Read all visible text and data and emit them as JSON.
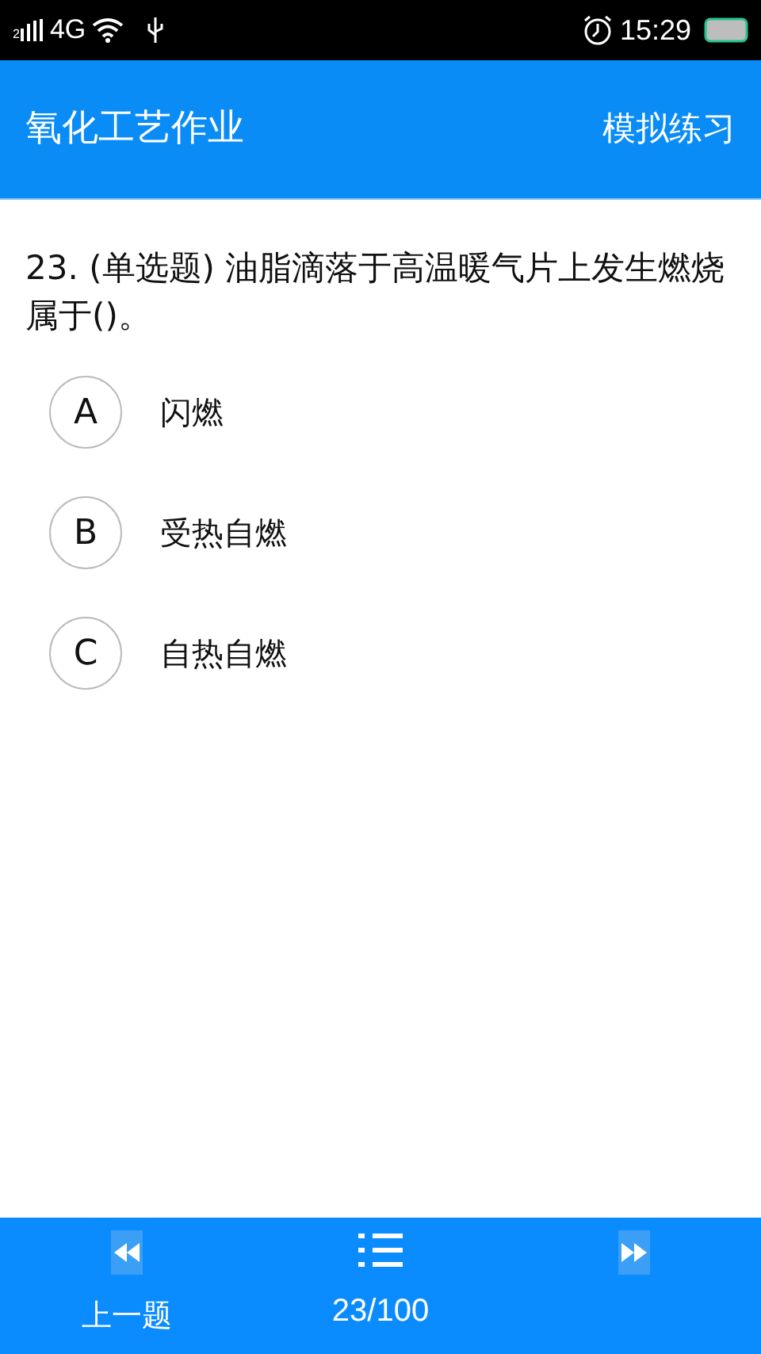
{
  "status_bar": {
    "sim": "2",
    "network": "4G",
    "time": "15:29"
  },
  "header": {
    "title": "氧化工艺作业",
    "mode": "模拟练习"
  },
  "question": {
    "text": "23. (单选题) 油脂滴落于高温暖气片上发生燃烧属于()。"
  },
  "options": [
    {
      "letter": "A",
      "text": "闪燃",
      "selected": false
    },
    {
      "letter": "B",
      "text": "受热自燃",
      "selected": false
    },
    {
      "letter": "C",
      "text": "自热自燃",
      "selected": false
    }
  ],
  "bottom_bar": {
    "prev": "上一题",
    "progress": "23/100"
  }
}
